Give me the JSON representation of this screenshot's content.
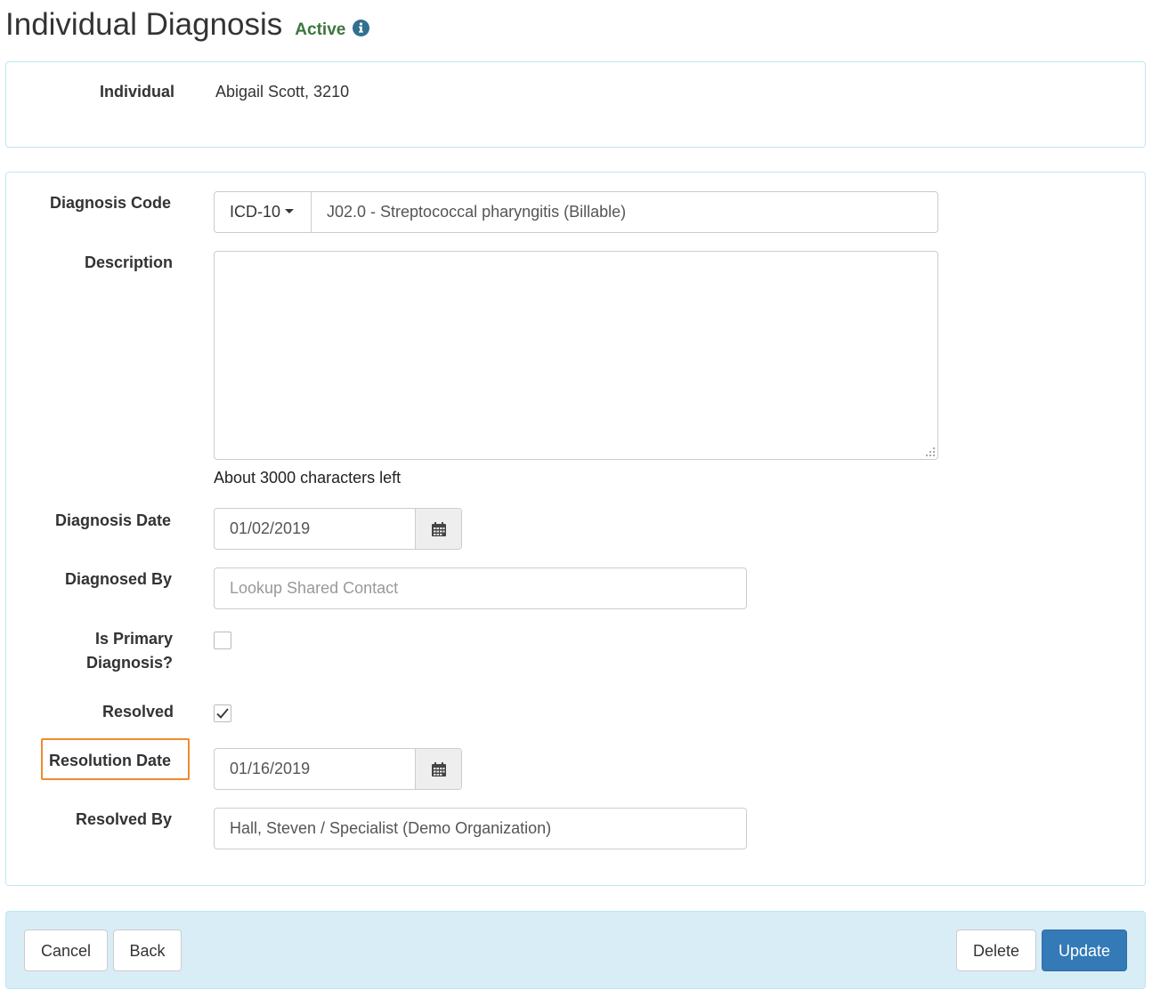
{
  "header": {
    "title": "Individual Diagnosis",
    "status": "Active",
    "status_color": "#3c763d",
    "info_icon": "info-circle-icon"
  },
  "individual": {
    "label": "Individual",
    "value": "Abigail Scott, 3210"
  },
  "form": {
    "diagnosis_code": {
      "label": "Diagnosis Code",
      "code_system": "ICD-10",
      "value": "J02.0 - Streptococcal pharyngitis (Billable)"
    },
    "description": {
      "label": "Description",
      "value": "",
      "char_count": "About 3000 characters left"
    },
    "diagnosis_date": {
      "label": "Diagnosis Date",
      "value": "01/02/2019",
      "icon": "calendar-icon"
    },
    "diagnosed_by": {
      "label": "Diagnosed By",
      "placeholder": "Lookup Shared Contact",
      "value": ""
    },
    "is_primary": {
      "label_line1": "Is Primary",
      "label_line2": "Diagnosis?",
      "checked": false
    },
    "resolved": {
      "label": "Resolved",
      "checked": true
    },
    "resolution_date": {
      "label": "Resolution Date",
      "value": "01/16/2019",
      "icon": "calendar-icon",
      "highlight_color": "#ef8a2e"
    },
    "resolved_by": {
      "label": "Resolved By",
      "value": "Hall, Steven / Specialist (Demo Organization)"
    }
  },
  "footer": {
    "cancel_label": "Cancel",
    "back_label": "Back",
    "delete_label": "Delete",
    "update_label": "Update",
    "primary_color": "#337ab7"
  }
}
